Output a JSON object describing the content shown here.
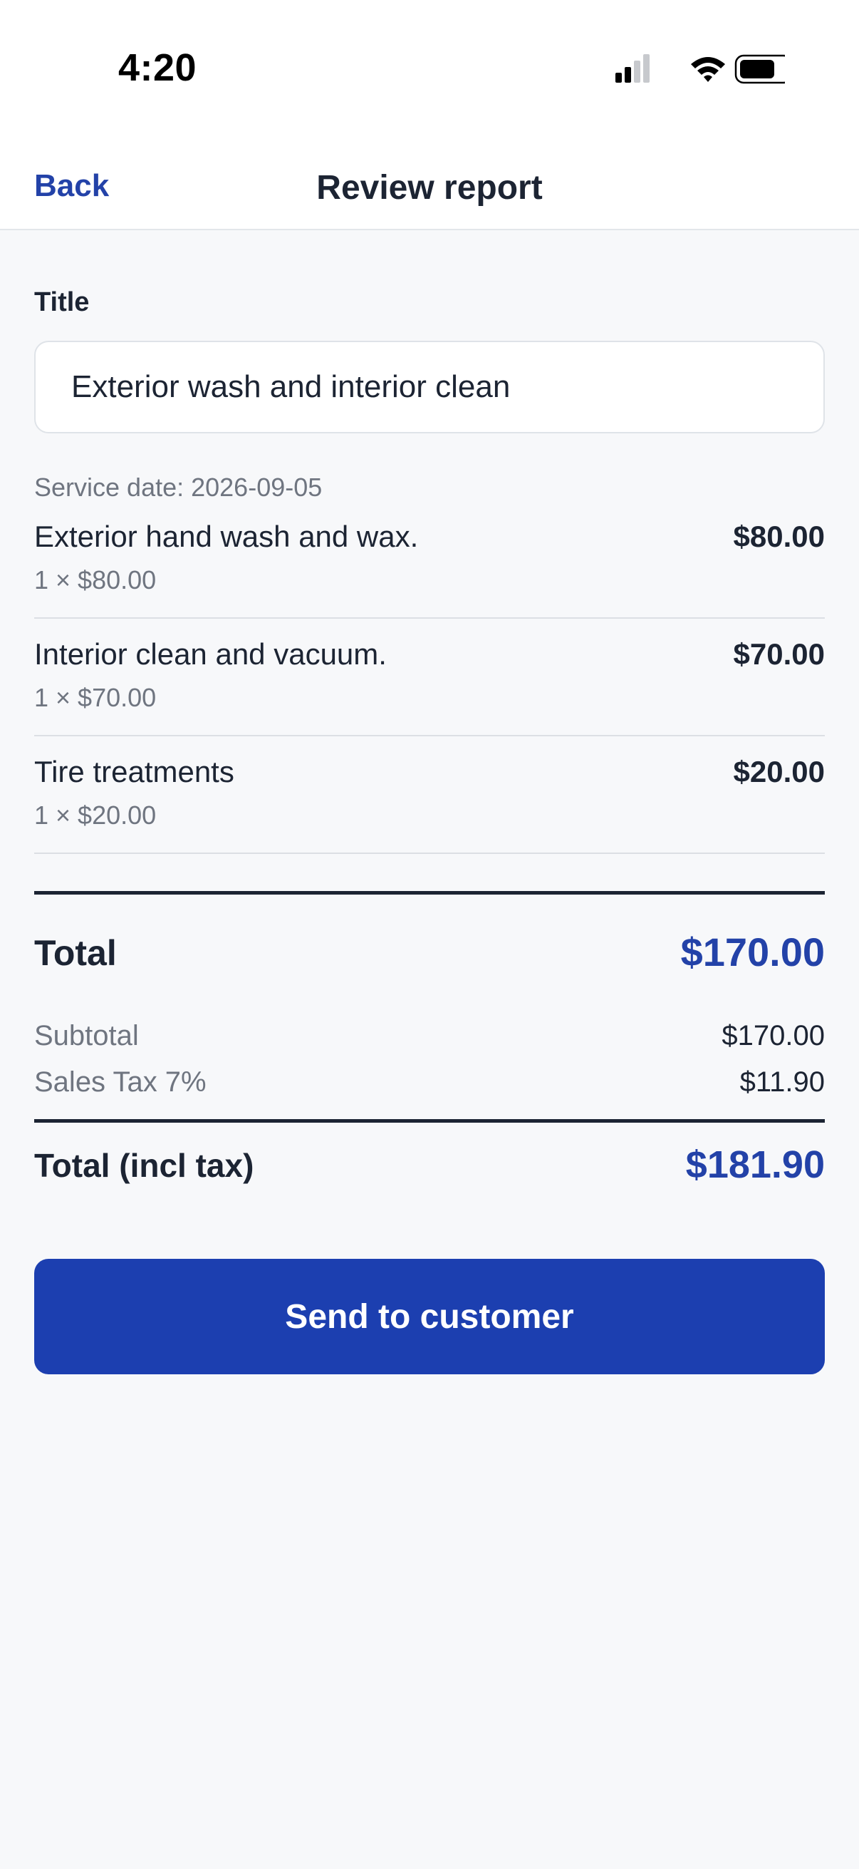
{
  "status_bar": {
    "time": "4:20",
    "icons": [
      "cellular-signal-icon",
      "wifi-icon",
      "battery-icon"
    ]
  },
  "nav": {
    "back_label": "Back",
    "title": "Review report"
  },
  "form": {
    "title_label": "Title",
    "title_value": "Exterior wash and interior clean",
    "service_date": "Service date: 2026-09-05"
  },
  "line_items": [
    {
      "name": "Exterior hand wash and wax.",
      "detail": "1 × $80.00",
      "amount": "$80.00"
    },
    {
      "name": "Interior clean and vacuum.",
      "detail": "1 × $70.00",
      "amount": "$70.00"
    },
    {
      "name": "Tire treatments",
      "detail": "1 × $20.00",
      "amount": "$20.00"
    }
  ],
  "totals": {
    "total_label": "Total",
    "total_value": "$170.00",
    "subtotal_label": "Subtotal",
    "subtotal_value": "$170.00",
    "tax_label": "Sales Tax 7%",
    "tax_value": "$11.90",
    "grand_label": "Total (incl tax)",
    "grand_value": "$181.90"
  },
  "actions": {
    "send_label": "Send to customer"
  },
  "colors": {
    "accent": "#1c3fb0",
    "link": "#2342a8",
    "text": "#1c2433",
    "muted": "#6f7580",
    "background": "#f7f8fa"
  }
}
